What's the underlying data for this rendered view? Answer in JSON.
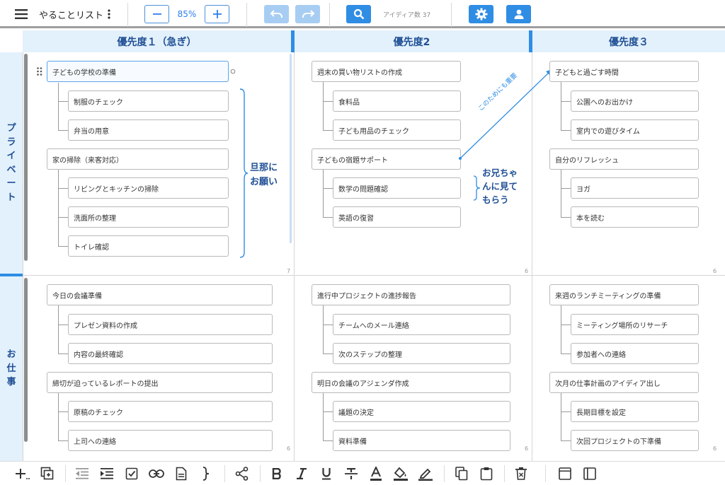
{
  "app": {
    "title": "やることリスト",
    "zoom": "85%",
    "idea_count": "アイディア数 37"
  },
  "columns": [
    {
      "label": "優先度１（急ぎ）"
    },
    {
      "label": "優先度2"
    },
    {
      "label": "優先度３"
    }
  ],
  "rows": [
    {
      "label": [
        "プ",
        "ラ",
        "イ",
        "ベ",
        "ー",
        "ト"
      ]
    },
    {
      "label": [
        "お",
        "仕",
        "事"
      ]
    }
  ],
  "cells": {
    "private_p1": {
      "count": "7",
      "groups": [
        {
          "title": "子どもの学校の準備",
          "children": [
            "制服のチェック",
            "弁当の用意"
          ]
        },
        {
          "title": "家の掃除（来客対応）",
          "children": [
            "リビングとキッチンの掃除",
            "洗面所の整理",
            "トイレ確認"
          ]
        }
      ]
    },
    "private_p2": {
      "count": "6",
      "groups": [
        {
          "title": "週末の買い物リストの作成",
          "children": [
            "食料品",
            "子ども用品のチェック"
          ]
        },
        {
          "title": "子どもの宿題サポート",
          "children": [
            "数学の問題確認",
            "英語の復習"
          ]
        }
      ]
    },
    "private_p3": {
      "count": "6",
      "groups": [
        {
          "title": "子どもと過ごす時間",
          "children": [
            "公園へのお出かけ",
            "室内での遊びタイム"
          ]
        },
        {
          "title": "自分のリフレッシュ",
          "children": [
            "ヨガ",
            "本を読む"
          ]
        }
      ]
    },
    "work_p1": {
      "count": "6",
      "groups": [
        {
          "title": "今日の会議準備",
          "children": [
            "プレゼン資料の作成",
            "内容の最終確認"
          ]
        },
        {
          "title": "締切が迫っているレポートの提出",
          "children": [
            "原稿のチェック",
            "上司への連絡"
          ]
        }
      ]
    },
    "work_p2": {
      "count": "6",
      "groups": [
        {
          "title": "進行中プロジェクトの進捗報告",
          "children": [
            "チームへのメール連絡",
            "次のステップの整理"
          ]
        },
        {
          "title": "明日の会議のアジェンダ作成",
          "children": [
            "議題の決定",
            "資料準備"
          ]
        }
      ]
    },
    "work_p3": {
      "count": "6",
      "groups": [
        {
          "title": "来週のランチミーティングの準備",
          "children": [
            "ミーティング場所のリサーチ",
            "参加者への連絡"
          ]
        },
        {
          "title": "次月の仕事計画のアイディア出し",
          "children": [
            "長期目標を設定",
            "次回プロジェクトの下準備"
          ]
        }
      ]
    }
  },
  "annotations": {
    "husband_note": [
      "旦那に",
      "お願い"
    ],
    "brother_note": [
      "お兄ちゃ",
      "んに見て",
      "もらう"
    ],
    "arrow_label": "このためにも重要"
  },
  "colors": {
    "accent": "#2f8de4",
    "header_bg": "#e3f1fc",
    "header_text": "#1f4f94"
  },
  "icons": {
    "top": [
      "menu-icon",
      "more-vert-icon",
      "zoom-out-icon",
      "zoom-in-icon",
      "undo-icon",
      "redo-icon",
      "search-icon",
      "settings-icon",
      "account-icon"
    ],
    "bottom": [
      "add-node-icon",
      "add-box-icon",
      "outdent-icon",
      "indent-icon",
      "checkbox-icon",
      "link-icon",
      "document-icon",
      "brace-icon",
      "connect-icon",
      "bold-icon",
      "italic-icon",
      "underline-icon",
      "strikethrough-icon",
      "text-color-icon",
      "fill-color-icon",
      "highlight-icon",
      "copy-icon",
      "paste-icon",
      "delete-icon",
      "single-pane-icon",
      "split-pane-icon"
    ]
  }
}
